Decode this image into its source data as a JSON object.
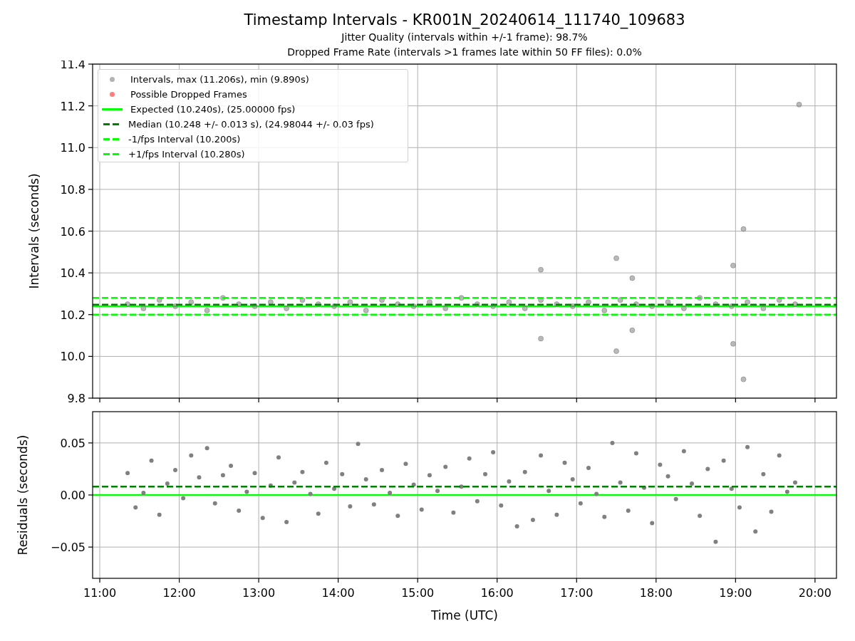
{
  "title": "Timestamp Intervals - KR001N_20240614_111740_109683",
  "subtitles": [
    "Jitter Quality (intervals within +/-1 frame): 98.7%",
    "Dropped Frame Rate (intervals >1 frames late within 50 FF files): 0.0%"
  ],
  "intervals_plot": {
    "chart_data": {
      "type": "scatter",
      "ylabel": "Intervals (seconds)",
      "xlim": [
        10.91,
        20.27
      ],
      "ylim": [
        9.8,
        11.4
      ],
      "grid": true,
      "yticks": [
        {
          "value": 9.8,
          "label": "9.8"
        },
        {
          "value": 10.0,
          "label": "10.0"
        },
        {
          "value": 10.2,
          "label": "10.2"
        },
        {
          "value": 10.4,
          "label": "10.4"
        },
        {
          "value": 10.6,
          "label": "10.6"
        },
        {
          "value": 10.8,
          "label": "10.8"
        },
        {
          "value": 11.0,
          "label": "11.0"
        },
        {
          "value": 11.2,
          "label": "11.2"
        },
        {
          "value": 11.4,
          "label": "11.4"
        }
      ],
      "x": [
        11.35,
        11.55,
        11.75,
        11.95,
        12.15,
        12.35,
        12.55,
        12.75,
        12.95,
        13.15,
        13.35,
        13.55,
        13.75,
        13.95,
        14.15,
        14.35,
        14.55,
        14.75,
        14.95,
        15.15,
        15.35,
        15.55,
        15.75,
        15.95,
        16.15,
        16.35,
        16.55,
        16.75,
        16.95,
        17.15,
        17.35,
        17.55,
        17.75,
        17.95,
        18.15,
        18.35,
        18.55,
        18.75,
        18.95,
        19.15,
        19.35,
        19.55,
        19.75,
        16.55,
        16.55,
        17.5,
        17.5,
        17.7,
        17.7,
        18.97,
        18.97,
        19.1,
        19.1,
        19.8
      ],
      "series": [
        {
          "color": "#808080",
          "values": [
            10.25,
            10.23,
            10.27,
            10.24,
            10.26,
            10.22,
            10.28,
            10.25,
            10.24,
            10.26,
            10.23,
            10.27,
            10.25,
            10.24,
            10.26,
            10.22,
            10.27,
            10.25,
            10.24,
            10.26,
            10.23,
            10.28,
            10.25,
            10.24,
            10.26,
            10.23,
            10.27,
            10.25,
            10.24,
            10.26,
            10.22,
            10.27,
            10.25,
            10.24,
            10.26,
            10.23,
            10.28,
            10.25,
            10.24,
            10.26,
            10.23,
            10.27,
            10.25,
            10.415,
            10.085,
            10.47,
            10.025,
            10.375,
            10.125,
            10.435,
            10.06,
            10.61,
            9.89,
            11.206
          ]
        }
      ],
      "ref_lines": [
        {
          "axis": "y",
          "value": 10.24,
          "color": "#00ff00"
        },
        {
          "axis": "y",
          "value": 10.248,
          "color": "#008000"
        },
        {
          "axis": "y",
          "value": 10.2,
          "color": "#00ff00"
        },
        {
          "axis": "y",
          "value": 10.28,
          "color": "#00ff00"
        }
      ]
    },
    "legend": [
      {
        "label": "Intervals, max (11.206s), min (9.890s)",
        "kind": "marker",
        "color": "#b3b3b3"
      },
      {
        "label": "Possible Dropped Frames",
        "kind": "marker",
        "color": "#ff7f7f"
      },
      {
        "label": "Expected (10.240s), (25.00000 fps)",
        "kind": "line",
        "color": "#00ff00"
      },
      {
        "label": "Median (10.248 +/- 0.013 s), (24.98044 +/- 0.03 fps)",
        "kind": "dashed",
        "color": "#008000"
      },
      {
        "label": "-1/fps Interval (10.200s)",
        "kind": "dashed",
        "color": "#00ff00"
      },
      {
        "label": "+1/fps Interval (10.280s)",
        "kind": "dashed",
        "color": "#00ff00"
      }
    ]
  },
  "residuals_plot": {
    "chart_data": {
      "type": "scatter",
      "xlabel": "Time (UTC)",
      "ylabel": "Residuals (seconds)",
      "grid": true,
      "xlim": [
        10.91,
        20.27
      ],
      "ylim": [
        -0.08,
        0.08
      ],
      "xticks": [
        {
          "value": 11,
          "label": "11:00"
        },
        {
          "value": 12,
          "label": "12:00"
        },
        {
          "value": 13,
          "label": "13:00"
        },
        {
          "value": 14,
          "label": "14:00"
        },
        {
          "value": 15,
          "label": "15:00"
        },
        {
          "value": 16,
          "label": "16:00"
        },
        {
          "value": 17,
          "label": "17:00"
        },
        {
          "value": 18,
          "label": "18:00"
        },
        {
          "value": 19,
          "label": "19:00"
        },
        {
          "value": 20,
          "label": "20:00"
        }
      ],
      "yticks": [
        {
          "value": -0.05,
          "label": "−0.05"
        },
        {
          "value": 0,
          "label": "0.00"
        },
        {
          "value": 0.05,
          "label": "0.05"
        }
      ],
      "x": [
        11.35,
        11.45,
        11.55,
        11.65,
        11.75,
        11.85,
        11.95,
        12.05,
        12.15,
        12.25,
        12.35,
        12.45,
        12.55,
        12.65,
        12.75,
        12.85,
        12.95,
        13.05,
        13.15,
        13.25,
        13.35,
        13.45,
        13.55,
        13.65,
        13.75,
        13.85,
        13.95,
        14.05,
        14.15,
        14.25,
        14.35,
        14.45,
        14.55,
        14.65,
        14.75,
        14.85,
        14.95,
        15.05,
        15.15,
        15.25,
        15.35,
        15.45,
        15.55,
        15.65,
        15.75,
        15.85,
        15.95,
        16.05,
        16.15,
        16.25,
        16.35,
        16.45,
        16.55,
        16.65,
        16.75,
        16.85,
        16.95,
        17.05,
        17.15,
        17.25,
        17.35,
        17.45,
        17.55,
        17.65,
        17.75,
        17.85,
        17.95,
        18.05,
        18.15,
        18.25,
        18.35,
        18.45,
        18.55,
        18.65,
        18.75,
        18.85,
        18.95,
        19.05,
        19.15,
        19.25,
        19.35,
        19.45,
        19.55,
        19.65,
        19.75
      ],
      "series": [
        {
          "color": "#808080",
          "values": [
            0.021,
            -0.012,
            0.002,
            0.033,
            -0.019,
            0.011,
            0.024,
            -0.003,
            0.038,
            0.017,
            0.045,
            -0.008,
            0.019,
            0.028,
            -0.015,
            0.003,
            0.021,
            -0.022,
            0.009,
            0.036,
            -0.026,
            0.012,
            0.022,
            0.001,
            -0.018,
            0.031,
            0.006,
            0.02,
            -0.011,
            0.049,
            0.015,
            -0.009,
            0.024,
            0.002,
            -0.02,
            0.03,
            0.01,
            -0.014,
            0.019,
            0.004,
            0.027,
            -0.017,
            0.008,
            0.035,
            -0.006,
            0.02,
            0.041,
            -0.01,
            0.013,
            -0.03,
            0.022,
            -0.024,
            0.038,
            0.004,
            -0.019,
            0.031,
            0.015,
            -0.008,
            0.026,
            0.001,
            -0.021,
            0.05,
            0.012,
            -0.015,
            0.04,
            0.007,
            -0.027,
            0.029,
            0.018,
            -0.004,
            0.042,
            0.011,
            -0.02,
            0.025,
            -0.045,
            0.033,
            0.006,
            -0.012,
            0.046,
            -0.035,
            0.02,
            -0.016,
            0.038,
            0.003,
            0.012
          ]
        }
      ],
      "ref_lines": [
        {
          "axis": "y",
          "value": 0,
          "color": "#00ff00"
        },
        {
          "axis": "y",
          "value": 0.008,
          "color": "#008000"
        }
      ]
    }
  }
}
